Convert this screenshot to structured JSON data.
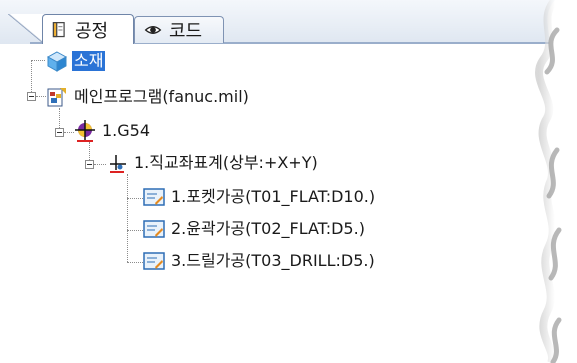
{
  "tabs": [
    {
      "label": "공정",
      "icon": "process-tab-icon",
      "active": true
    },
    {
      "label": "코드",
      "icon": "eye-icon",
      "active": false
    }
  ],
  "tree": {
    "material": {
      "label": "소재",
      "icon": "material-cube-icon",
      "selected": true
    },
    "main_program": {
      "label": "메인프로그램(fanuc.mil)",
      "icon": "program-icon"
    },
    "work_coord": {
      "label": "1.G54",
      "icon": "coordinate-origin-icon"
    },
    "coord_system": {
      "label": "1.직교좌표계(상부:+X+Y)",
      "icon": "axis-icon"
    },
    "operations": [
      {
        "label": "1.포켓가공(T01_FLAT:D10.)",
        "icon": "operation-icon"
      },
      {
        "label": "2.윤곽가공(T02_FLAT:D5.)",
        "icon": "operation-icon"
      },
      {
        "label": "3.드릴가공(T03_DRILL:D5.)",
        "icon": "operation-icon"
      }
    ]
  },
  "colors": {
    "selection": "#2a73d6",
    "tab_border": "#7f93b3"
  }
}
